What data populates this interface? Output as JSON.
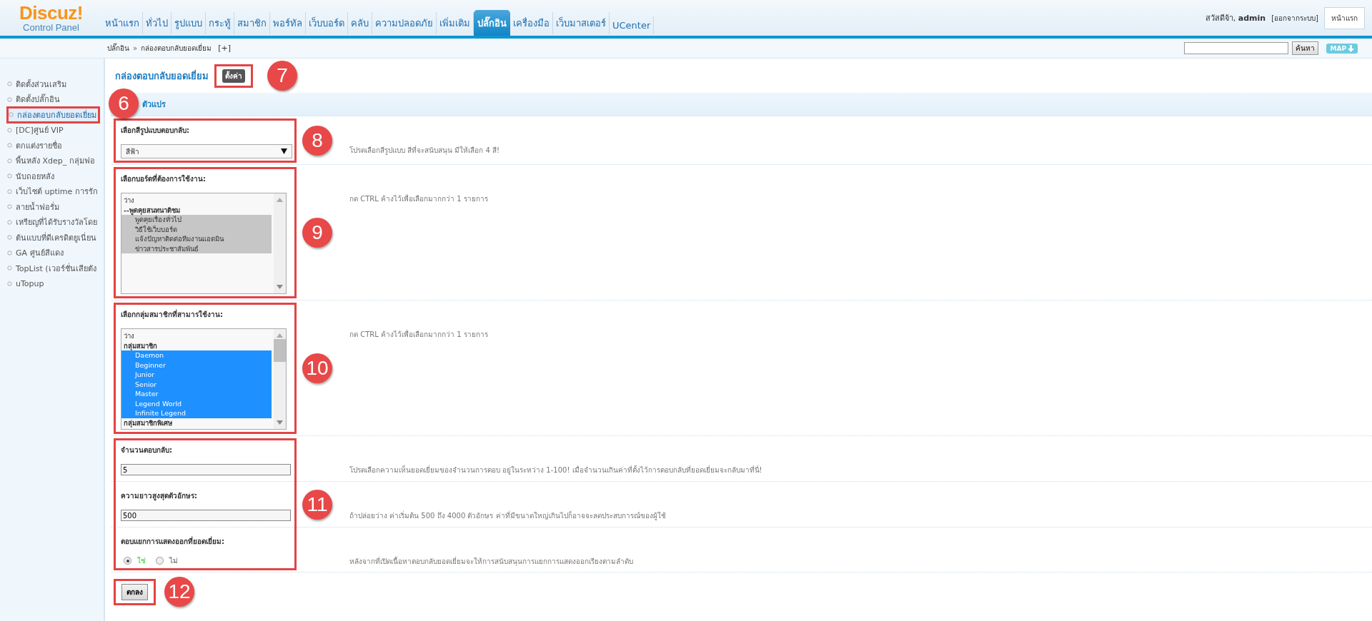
{
  "logo": {
    "title": "Discuz!",
    "subtitle": "Control Panel"
  },
  "nav": [
    {
      "label": "หน้าแรก",
      "selected": false
    },
    {
      "label": "ทั่วไป",
      "selected": false
    },
    {
      "label": "รูปแบบ",
      "selected": false
    },
    {
      "label": "กระทู้",
      "selected": false
    },
    {
      "label": "สมาชิก",
      "selected": false
    },
    {
      "label": "พอร์ทัล",
      "selected": false
    },
    {
      "label": "เว็บบอร์ด",
      "selected": false
    },
    {
      "label": "คลับ",
      "selected": false
    },
    {
      "label": "ความปลอดภัย",
      "selected": false
    },
    {
      "label": "เพิ่มเติม",
      "selected": false
    },
    {
      "label": "ปลั๊กอิน",
      "selected": true
    },
    {
      "label": "เครื่องมือ",
      "selected": false
    },
    {
      "label": "เว็บมาสเตอร์",
      "selected": false
    },
    {
      "label": "UCenter",
      "selected": false
    }
  ],
  "user": {
    "greeting": "สวัสดีจ้า, **admin**",
    "logout": "[ออกจากระบบ]",
    "home_button": "หน้าแรก"
  },
  "breadcrumb": {
    "items": [
      "ปลั๊กอิน",
      "กล่องตอบกลับยอดเยี่ยม"
    ],
    "separator": "»",
    "add": "[+]"
  },
  "search": {
    "button": "ค้นหา",
    "map": "MAP"
  },
  "sidebar": {
    "items": [
      {
        "label": "ติดตั้งส่วนเสริม",
        "selected": false
      },
      {
        "label": "ติดตั้งปลั๊กอิน",
        "selected": false
      },
      {
        "label": "กล่องตอบกลับยอดเยี่ยม",
        "selected": true
      },
      {
        "label": "[DC]ศูนย์ VIP",
        "selected": false
      },
      {
        "label": "ตกแต่งรายชื่อ",
        "selected": false
      },
      {
        "label": "พื้นหลัง Xdep_ กลุ่มฟอ",
        "selected": false
      },
      {
        "label": "นับถอยหลัง",
        "selected": false
      },
      {
        "label": "เว็บไซต์ uptime การรัก",
        "selected": false
      },
      {
        "label": "ลายน้ำฟอรั่ม",
        "selected": false
      },
      {
        "label": "เหรียญที่ได้รับรางวัลโดย",
        "selected": false
      },
      {
        "label": "ต้นแบบที่ดีเครดิตยูเนี่ยน",
        "selected": false
      },
      {
        "label": "GA ศูนย์สีแดง",
        "selected": false
      },
      {
        "label": "TopList (เวอร์ชั่นเสียตัง",
        "selected": false
      },
      {
        "label": "uTopup",
        "selected": false
      }
    ]
  },
  "page": {
    "title": "กล่องตอบกลับยอดเยี่ยม",
    "settings_button": "ตั้งค่า",
    "settings_callout": "7",
    "section": "ตัวแปร",
    "section_callout": "6"
  },
  "form": [
    {
      "callout": "8",
      "fields": [
        {
          "kind": "select",
          "label": "เลือกสีรูปแบบตอบกลับ:",
          "value": "สีฟ้า",
          "hint": "โปรดเลือกสีรูปแบบ สีที่จะสนับสนุน มีให้เลือก 4 สี!"
        }
      ]
    },
    {
      "callout": "9",
      "fields": [
        {
          "kind": "list",
          "label": "เลือกบอร์ดที่ต้องการใช้งาน:",
          "focused": false,
          "scroll_thumb": false,
          "hint": "กด CTRL ค้างไว้เพื่อเลือกมากกว่า 1 รายการ",
          "options": [
            {
              "label": "ว่าง",
              "kind": "option",
              "selected": false
            },
            {
              "label": "--พูดคุยสนทนาติชม",
              "kind": "group",
              "selected": false,
              "children": [
                {
                  "label": "พูดคุยเรื่องทั่วไป",
                  "kind": "option",
                  "selected": true
                },
                {
                  "label": "วิธีใช้เว็บบอร์ด",
                  "kind": "option",
                  "selected": true
                },
                {
                  "label": "แจ้งปัญหาติดต่อทีมงานแอดมิน",
                  "kind": "option",
                  "selected": true
                },
                {
                  "label": "ข่าวสารประชาสัมพันธ์",
                  "kind": "option",
                  "selected": true
                }
              ]
            }
          ]
        }
      ]
    },
    {
      "callout": "10",
      "fields": [
        {
          "kind": "list",
          "label": "เลือกกลุ่มสมาชิกที่สามารใช้งาน:",
          "focused": true,
          "scroll_thumb": true,
          "hint": "กด CTRL ค้างไว้เพื่อเลือกมากกว่า 1 รายการ",
          "options": [
            {
              "label": "ว่าง",
              "kind": "option",
              "selected": false
            },
            {
              "label": "กลุ่มสมาชิก",
              "kind": "group",
              "selected": false,
              "children": [
                {
                  "label": "Daemon",
                  "kind": "option",
                  "selected": true
                },
                {
                  "label": "Beginner",
                  "kind": "option",
                  "selected": true
                },
                {
                  "label": "Junior",
                  "kind": "option",
                  "selected": true
                },
                {
                  "label": "Senior",
                  "kind": "option",
                  "selected": true
                },
                {
                  "label": "Master",
                  "kind": "option",
                  "selected": true
                },
                {
                  "label": "Legend World",
                  "kind": "option",
                  "selected": true
                },
                {
                  "label": "Infinite Legend",
                  "kind": "option",
                  "selected": true
                }
              ]
            },
            {
              "label": "กลุ่มสมาชิกพิเศษ",
              "kind": "group",
              "selected": false
            }
          ]
        }
      ]
    },
    {
      "callout": "11",
      "fields": [
        {
          "kind": "text",
          "label": "จำนวนตอบกลับ:",
          "value": "5",
          "hint": "โปรดเลือกความเห็นยอดเยี่ยมของจำนวนการตอบ อยู่ในระหว่าง 1-100! เมื่อจำนวนเกินค่าที่ตั้งไว้การตอบกลับที่ยอดเยี่ยมจะกลับมาที่นี่!"
        },
        {
          "kind": "text",
          "label": "ความยาวสูงสุดตัวอักษร:",
          "value": "500",
          "hint": "ถ้าปล่อยว่าง ค่าเริ่มต้น 500 ถึง 4000 ตัวอักษร ค่าที่มีขนาดใหญ่เกินไปก็อาจจะลดประสบการณ์ของผู้ใช้"
        },
        {
          "kind": "radio",
          "label": "ตอบแยกการแสดงออกที่ยอดเยี่ยม:",
          "hint": "หลังจากที่เปิดเนื้อหาตอบกลับยอดเยี่ยมจะให้การสนับสนุนการแยกการแสดงออกเรียงตามลำดับ",
          "options": [
            {
              "label": "ใช่",
              "selected": true
            },
            {
              "label": "ไม่",
              "selected": false
            }
          ]
        }
      ]
    }
  ],
  "submit": {
    "label": "ตกลง",
    "callout": "12"
  }
}
